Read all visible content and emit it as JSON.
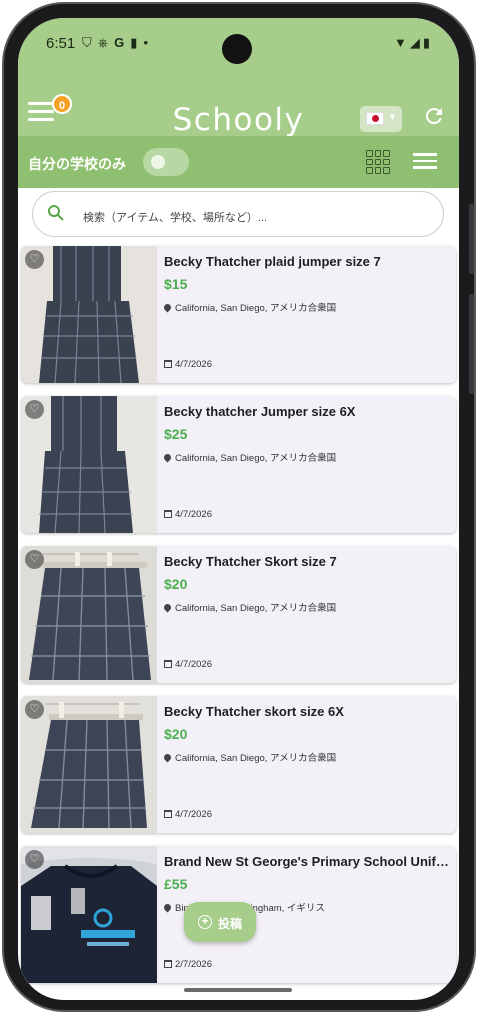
{
  "status_bar": {
    "time": "6:51",
    "left_icons": [
      "shield-icon",
      "usb-icon",
      "google-icon",
      "sim-icon",
      "dot-icon"
    ],
    "right_icons": [
      "wifi-icon",
      "signal-icon",
      "battery-icon"
    ]
  },
  "app_bar": {
    "title": "Schooly",
    "notification_count": "0",
    "language_flag": "jp-flag",
    "refresh_icon": "refresh-icon"
  },
  "filter_bar": {
    "own_school_label": "自分の学校のみ",
    "own_school_only": false,
    "view_modes": [
      "grid-view-icon",
      "list-view-icon"
    ]
  },
  "search": {
    "placeholder": "検索（アイテム、学校、場所など）..."
  },
  "items": [
    {
      "title": "Becky Thatcher plaid jumper size 7",
      "price": "$15",
      "location": "California, San Diego, アメリカ合衆国",
      "date": "4/7/2026",
      "image": "plaid-jumper-photo"
    },
    {
      "title": "Becky thatcher Jumper size 6X",
      "price": "$25",
      "location": "California, San Diego, アメリカ合衆国",
      "date": "4/7/2026",
      "image": "plaid-jumper-photo"
    },
    {
      "title": "Becky Thatcher Skort size 7",
      "price": "$20",
      "location": "California, San Diego, アメリカ合衆国",
      "date": "4/7/2026",
      "image": "plaid-skort-photo"
    },
    {
      "title": "Becky Thatcher skort size 6X",
      "price": "$20",
      "location": "California, San Diego, アメリカ合衆国",
      "date": "4/7/2026",
      "image": "plaid-skort-photo"
    },
    {
      "title": "Brand New St George's Primary School Uniform",
      "price": "£55",
      "location": "Birmingham, Birmingham, イギリス",
      "date": "2/7/2026",
      "image": "sweatshirt-photo"
    }
  ],
  "fab": {
    "label": "投稿",
    "icon": "plus-circle-icon"
  },
  "colors": {
    "primary": "#a6cd8a",
    "filter_bar": "#8fbf70",
    "price": "#4caf50",
    "badge": "#f6a025",
    "card": "#f4f0f7"
  }
}
